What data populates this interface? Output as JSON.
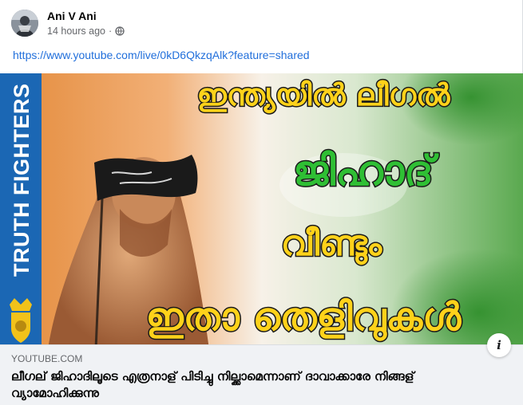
{
  "post": {
    "author": "Ani V Ani",
    "timestamp": "14 hours ago",
    "separator": "·",
    "privacy_icon": "globe-icon",
    "link_text": "https://www.youtube.com/live/0kD6QkzqAlk?feature=shared"
  },
  "thumbnail": {
    "side_banner": "TRUTH FIGHTERS",
    "line1": "ഇന്ത്യയിൽ ലീഗൽ",
    "line2": "ജിഹാദ്",
    "line3": "വീണ്ടും",
    "line4": "ഇതാ തെളിവുകൾ"
  },
  "preview": {
    "domain": "YOUTUBE.COM",
    "title": "ലീഗല് ജിഹാദിലൂടെ എത്രനാള് പിടിച്ചു നില്ക്കാമെന്നാണ് ദാവാക്കാരേ നിങ്ങള് വ്യാമോഹിക്കുന്നു",
    "info_label": "i"
  },
  "colors": {
    "link": "#216fdb",
    "preview_bg": "#f0f2f5",
    "banner_blue": "#1b67b4",
    "headline_yellow": "#ffd21a",
    "headline_green": "#2fbf34"
  }
}
